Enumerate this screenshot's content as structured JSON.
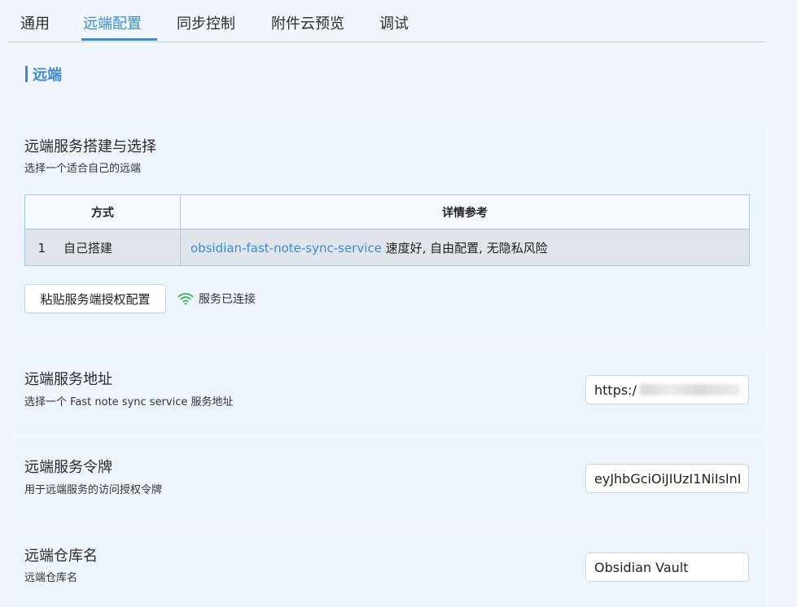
{
  "tabs": [
    {
      "label": "通用"
    },
    {
      "label": "远端配置"
    },
    {
      "label": "同步控制"
    },
    {
      "label": "附件云预览"
    },
    {
      "label": "调试"
    }
  ],
  "active_tab": "远端配置",
  "section": {
    "title": "远端"
  },
  "service_setup": {
    "title": "远端服务搭建与选择",
    "desc": "选择一个适合自己的远端",
    "table": {
      "headers": [
        "方式",
        "详情参考"
      ],
      "rows": [
        {
          "index": "1",
          "method": "自己搭建",
          "link": "obsidian-fast-note-sync-service",
          "detail": " 速度好, 自由配置, 无隐私风险"
        }
      ]
    },
    "paste_button": "粘贴服务端授权配置",
    "status": "服务已连接"
  },
  "address": {
    "title": "远端服务地址",
    "desc": "选择一个 Fast note sync service 服务地址",
    "value": "https:/"
  },
  "token": {
    "title": "远端服务令牌",
    "desc": "用于远端服务的访问授权令牌",
    "value": "eyJhbGciOiJIUzI1NiIsInI"
  },
  "vault": {
    "title": "远端仓库名",
    "desc": "远端仓库名",
    "value": "Obsidian Vault"
  },
  "colors": {
    "accent": "#3a8ad6",
    "status_icon": "#3cb15a",
    "background": "#f1f6fc"
  }
}
